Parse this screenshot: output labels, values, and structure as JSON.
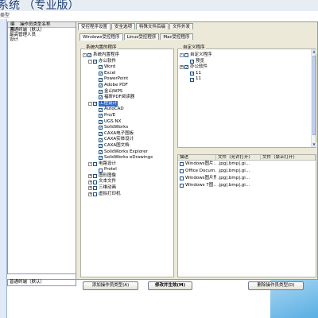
{
  "window": {
    "title": "系统 （专业版）",
    "subtitle": "类型"
  },
  "left_panel": {
    "headers": [
      "编号",
      "操作员类型名称"
    ],
    "items": [
      "普通终端（默认）",
      "最高管理人员",
      "设计"
    ],
    "current_type": "普通终端（默认）"
  },
  "top_tabs": [
    {
      "label": "受控程序设置",
      "active": true
    },
    {
      "label": "安全选项",
      "active": false
    },
    {
      "label": "特殊文件后缀",
      "active": false
    },
    {
      "label": "文件外发",
      "active": false
    }
  ],
  "sub_tabs": [
    {
      "label": "Windows受控程序",
      "active": true
    },
    {
      "label": "Linux受控程序",
      "active": false
    },
    {
      "label": "Mac受控程序",
      "active": false
    }
  ],
  "system_tree": {
    "title": "系统内置的程序",
    "nodes": [
      {
        "label": "系统内置程序",
        "level": 0,
        "expander": "-",
        "checked": true,
        "selected": false
      },
      {
        "label": "办公软件",
        "level": 1,
        "expander": "-",
        "checked": true,
        "selected": false
      },
      {
        "label": "Word",
        "level": 2,
        "expander": "",
        "checked": true,
        "selected": false
      },
      {
        "label": "Excel",
        "level": 2,
        "expander": "",
        "checked": true,
        "selected": false
      },
      {
        "label": "PowerPoint",
        "level": 2,
        "expander": "",
        "checked": true,
        "selected": false
      },
      {
        "label": "Adobe PDF",
        "level": 2,
        "expander": "",
        "checked": true,
        "selected": false
      },
      {
        "label": "金山WPS",
        "level": 2,
        "expander": "",
        "checked": true,
        "selected": false
      },
      {
        "label": "福昕PDF阅读器",
        "level": 2,
        "expander": "",
        "checked": true,
        "selected": false
      },
      {
        "label": "工程设计",
        "level": 1,
        "expander": "-",
        "checked": true,
        "selected": true
      },
      {
        "label": "AutoCAD",
        "level": 2,
        "expander": "",
        "checked": true,
        "selected": false
      },
      {
        "label": "Pro/E",
        "level": 2,
        "expander": "",
        "checked": true,
        "selected": false
      },
      {
        "label": "UGS NX",
        "level": 2,
        "expander": "",
        "checked": true,
        "selected": false
      },
      {
        "label": "SolidWorks",
        "level": 2,
        "expander": "",
        "checked": true,
        "selected": false
      },
      {
        "label": "CAXA电子图板",
        "level": 2,
        "expander": "",
        "checked": true,
        "selected": false
      },
      {
        "label": "CAXA实体设计",
        "level": 2,
        "expander": "",
        "checked": true,
        "selected": false
      },
      {
        "label": "CAXA图文档",
        "level": 2,
        "expander": "",
        "checked": true,
        "selected": false
      },
      {
        "label": "SolidWorks Explorer",
        "level": 2,
        "expander": "",
        "checked": true,
        "selected": false
      },
      {
        "label": "SolidWorks eDrawings",
        "level": 2,
        "expander": "",
        "checked": true,
        "selected": false
      },
      {
        "label": "电路设计",
        "level": 1,
        "expander": "-",
        "checked": false,
        "selected": false
      },
      {
        "label": "Protel",
        "level": 2,
        "expander": "",
        "checked": false,
        "selected": false
      },
      {
        "label": "图形图像",
        "level": 1,
        "expander": "+",
        "checked": false,
        "selected": false
      },
      {
        "label": "文本文件",
        "level": 1,
        "expander": "+",
        "checked": false,
        "selected": false
      },
      {
        "label": "三维动画",
        "level": 1,
        "expander": "+",
        "checked": false,
        "selected": false
      },
      {
        "label": "虚拟打印机",
        "level": 1,
        "expander": "+",
        "checked": false,
        "selected": false
      }
    ]
  },
  "custom_tree": {
    "title": "自定义程序",
    "nodes": [
      {
        "label": "自定义程序",
        "level": 0,
        "expander": "-",
        "checked": false
      },
      {
        "label": "预览",
        "level": 1,
        "expander": "",
        "checked": true
      },
      {
        "label": "办公软件",
        "level": 0,
        "expander": "+",
        "checked": true
      },
      {
        "label": "11",
        "level": 1,
        "expander": "",
        "checked": true
      },
      {
        "label": "11",
        "level": 1,
        "expander": "",
        "checked": true
      }
    ]
  },
  "ext_table": {
    "headers": [
      "描述",
      "文件（允许打开）",
      "文件（禁止打开）"
    ],
    "rows": [
      {
        "desc": "Windows图片...",
        "allow": ".jpg|.bmp|.gi..."
      },
      {
        "desc": "Office Docum...",
        "allow": ".jpg|.bmp|.gi..."
      },
      {
        "desc": "Windows图片预览",
        "allow": ".jpg|.bmp|.gi..."
      },
      {
        "desc": "Windows 7图...",
        "allow": ".jpg|.bmp|.gi..."
      }
    ]
  },
  "buttons": {
    "add": "添加操作员类型(A)",
    "save": "修改并生效(M)",
    "delete": "删除操作员类型(D)"
  }
}
